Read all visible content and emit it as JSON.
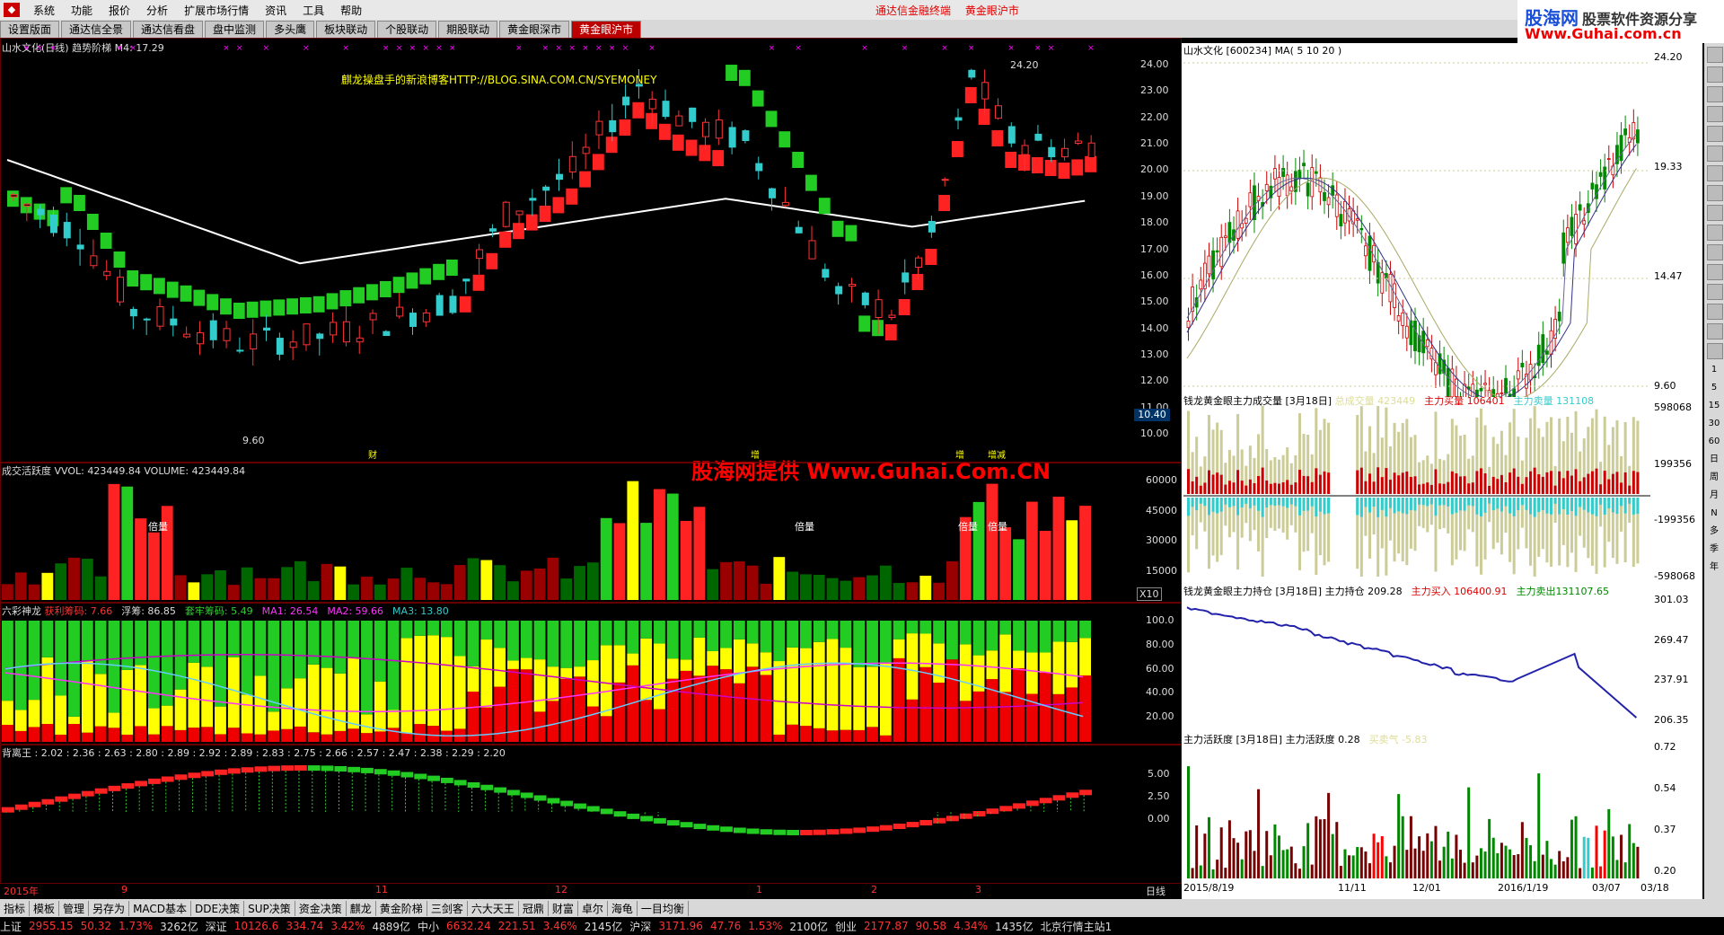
{
  "menu": {
    "items": [
      "系统",
      "功能",
      "报价",
      "分析",
      "扩展市场行情",
      "资讯",
      "工具",
      "帮助"
    ],
    "center": [
      "通达信金融终端",
      "黄金眼沪市"
    ]
  },
  "brand": {
    "line1": "股海网",
    "line1b": "股票软件资源分享",
    "line2": "Www.Guhai.com.cn"
  },
  "tabs": [
    "设置版面",
    "通达信全景",
    "通达信看盘",
    "盘中监测",
    "多头鹰",
    "板块联动",
    "个股联动",
    "期股联动",
    "黄金眼深市",
    "黄金眼沪市"
  ],
  "tabs_active": 9,
  "main": {
    "title": "山水文化(日线) 趋势阶梯  M4: 17.29",
    "blog": "麒龙操盘手的新浪博客HTTP://BLOG.SINA.COM.CN/SYEMONEY",
    "watermark": "股海网提供 Www.Guhai.Com.CN",
    "price_axis": [
      "24.00",
      "23.00",
      "22.00",
      "21.00",
      "20.00",
      "19.00",
      "18.00",
      "17.00",
      "16.00",
      "15.00",
      "14.00",
      "13.00",
      "12.00",
      "11.00",
      "10.00"
    ],
    "high_label": "24.20",
    "low_label": "9.60",
    "current": "10.40",
    "marks": [
      "财",
      "增",
      "增",
      "增减"
    ]
  },
  "vol": {
    "title": "成交活跃度  VVOL: 423449.84  VOLUME: 423449.84",
    "axis": [
      "60000",
      "45000",
      "30000",
      "15000"
    ],
    "unit": "X10",
    "labels": [
      "倍量",
      "倍量",
      "倍量",
      "倍量"
    ]
  },
  "six": {
    "title": "六彩神龙",
    "items": [
      {
        "t": "获利筹码: 7.66",
        "c": "#f33"
      },
      {
        "t": "浮筹: 86.85",
        "c": "#ddd"
      },
      {
        "t": "套牢筹码: 5.49",
        "c": "#3c3"
      },
      {
        "t": "MA1: 26.54",
        "c": "#f3f"
      },
      {
        "t": "MA2: 59.66",
        "c": "#f3f"
      },
      {
        "t": "MA3: 13.80",
        "c": "#3cc"
      }
    ],
    "axis": [
      "100.0",
      "80.00",
      "60.00",
      "40.00",
      "20.00"
    ]
  },
  "back": {
    "title": "背离王 : 2.02 : 2.36 : 2.63 : 2.80 : 2.89 : 2.92 : 2.89 : 2.83 : 2.75 : 2.66 : 2.57 : 2.47 : 2.38 : 2.29 : 2.20",
    "axis": [
      "5.00",
      "2.50",
      "0.00"
    ]
  },
  "dates": [
    "2015年",
    "9",
    "11",
    "12",
    "1",
    "2",
    "3"
  ],
  "period": "日线",
  "right": {
    "k_title": "山水文化  [600234] MA( 5 10 20 )",
    "k_axis": [
      "24.20",
      "19.33",
      "14.47",
      "9.60"
    ],
    "vol_title": "钱龙黄金眼主力成交量 [3月18日]",
    "vol_items": [
      {
        "t": "总成交量 423449",
        "c": "#dd9"
      },
      {
        "t": "主力买量 106401",
        "c": "#d00"
      },
      {
        "t": "主力卖量 131108",
        "c": "#3cc"
      }
    ],
    "vol_axis": [
      "598068",
      "199356",
      "-199356",
      "-598068"
    ],
    "hold_title": "钱龙黄金眼主力持仓 [3月18日]",
    "hold_items": [
      {
        "t": "主力持仓 209.28",
        "c": "#000"
      },
      {
        "t": "主力买入 106400.91",
        "c": "#d00"
      },
      {
        "t": "主力卖出131107.65",
        "c": "#080"
      }
    ],
    "hold_axis": [
      "301.03",
      "269.47",
      "237.91",
      "206.35"
    ],
    "act_title": "主力活跃度 [3月18日]",
    "act_items": [
      {
        "t": "主力活跃度 0.28",
        "c": "#000"
      },
      {
        "t": "买卖气 -5.83",
        "c": "#dd9"
      }
    ],
    "act_axis": [
      "0.72",
      "0.54",
      "0.37",
      "0.20"
    ],
    "dates": [
      "2015/8/19",
      "11/11",
      "12/01",
      "2016/1/19",
      "03/07",
      "03/18"
    ]
  },
  "rtools_labels": [
    "1",
    "5",
    "15",
    "30",
    "60",
    "日",
    "周",
    "月",
    "N",
    "多",
    "季",
    "年"
  ],
  "bottom_tabs": [
    "指标",
    "模板",
    "管理",
    "另存为",
    "MACD基本",
    "DDE决策",
    "SUP决策",
    "资金决策",
    "麒龙",
    "黄金阶梯",
    "三剑客",
    "六大天王",
    "冠鼎",
    "财富",
    "卓尔",
    "海龟",
    "一目均衡"
  ],
  "status": [
    {
      "t": "上证",
      "c": "#ddd"
    },
    {
      "t": "2955.15",
      "c": "#f33"
    },
    {
      "t": "50.32",
      "c": "#f33"
    },
    {
      "t": "1.73%",
      "c": "#f33"
    },
    {
      "t": "3262亿",
      "c": "#ddd"
    },
    {
      "t": "深证",
      "c": "#ddd"
    },
    {
      "t": "10126.6",
      "c": "#f33"
    },
    {
      "t": "334.74",
      "c": "#f33"
    },
    {
      "t": "3.42%",
      "c": "#f33"
    },
    {
      "t": "4889亿",
      "c": "#ddd"
    },
    {
      "t": "中小",
      "c": "#ddd"
    },
    {
      "t": "6632.24",
      "c": "#f33"
    },
    {
      "t": "221.51",
      "c": "#f33"
    },
    {
      "t": "3.46%",
      "c": "#f33"
    },
    {
      "t": "2145亿",
      "c": "#ddd"
    },
    {
      "t": "沪深",
      "c": "#ddd"
    },
    {
      "t": "3171.96",
      "c": "#f33"
    },
    {
      "t": "47.76",
      "c": "#f33"
    },
    {
      "t": "1.53%",
      "c": "#f33"
    },
    {
      "t": "2100亿",
      "c": "#ddd"
    },
    {
      "t": "创业",
      "c": "#ddd"
    },
    {
      "t": "2177.87",
      "c": "#f33"
    },
    {
      "t": "90.58",
      "c": "#f33"
    },
    {
      "t": "4.34%",
      "c": "#f33"
    },
    {
      "t": "1435亿",
      "c": "#ddd"
    },
    {
      "t": "北京行情主站1",
      "c": "#ddd"
    }
  ]
}
